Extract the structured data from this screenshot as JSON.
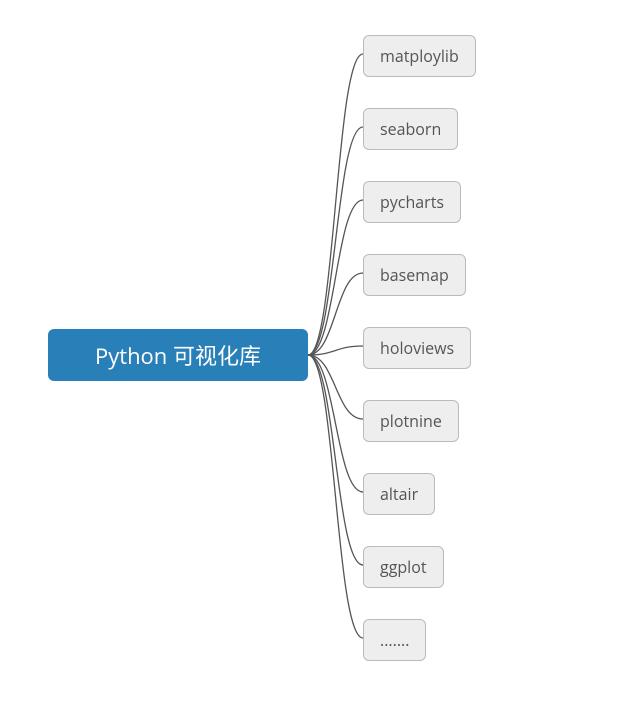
{
  "root": {
    "label": "Python 可视化库"
  },
  "children": [
    {
      "label": "matploylib"
    },
    {
      "label": "seaborn"
    },
    {
      "label": "pycharts"
    },
    {
      "label": "basemap"
    },
    {
      "label": "holoviews"
    },
    {
      "label": "plotnine"
    },
    {
      "label": "altair"
    },
    {
      "label": "ggplot"
    },
    {
      "label": "......."
    }
  ],
  "layout": {
    "rootCenterY": 355,
    "rootRightX": 308,
    "childLeftX": 363,
    "childStartY": 35,
    "childSpacing": 73
  }
}
